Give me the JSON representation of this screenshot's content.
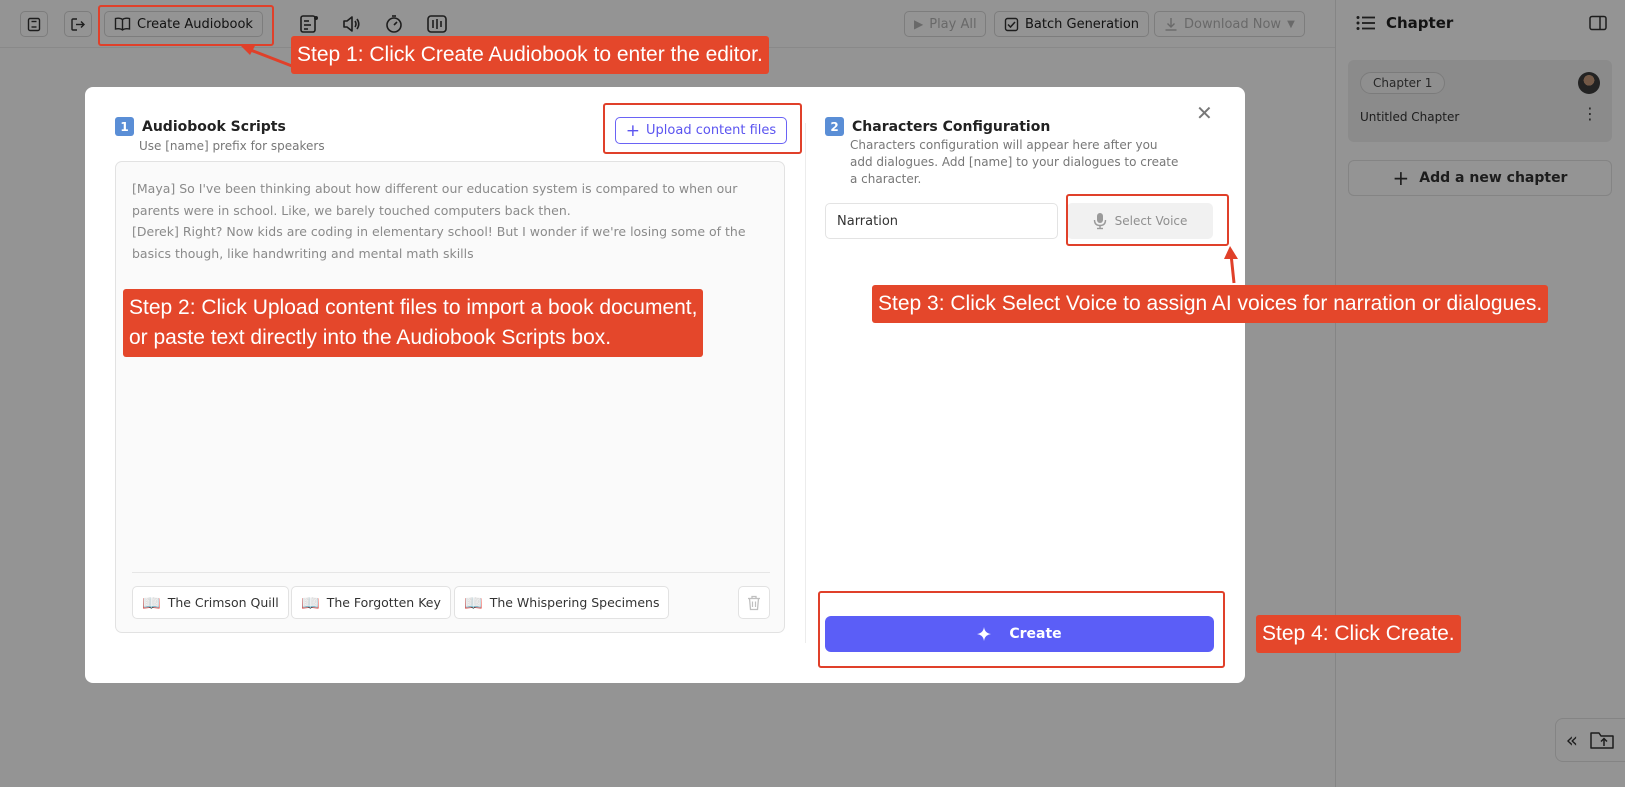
{
  "toolbar": {
    "create_audiobook_label": "Create Audiobook",
    "play_all_label": "Play All",
    "batch_generation_label": "Batch Generation",
    "download_now_label": "Download Now"
  },
  "right_panel": {
    "title": "Chapter",
    "chapter_pill": "Chapter 1",
    "chapter_name": "Untitled Chapter",
    "add_chapter_label": "Add a new chapter"
  },
  "modal": {
    "scripts": {
      "badge": "1",
      "title": "Audiobook Scripts",
      "subtitle": "Use [name] prefix for speakers",
      "upload_label": "Upload content files",
      "script_lines": [
        "[Maya] So I've been thinking about how different our education system is compared to when our parents were in school. Like, we barely touched computers back then.",
        "[Derek] Right? Now kids are coding in elementary school! But I wonder if we're losing some of the basics though, like handwriting and mental math skills"
      ],
      "samples": [
        "The Crimson Quill",
        "The Forgotten Key",
        "The Whispering Specimens"
      ]
    },
    "characters": {
      "badge": "2",
      "title": "Characters Configuration",
      "subtitle": "Characters configuration will appear here after you add dialogues. Add [name] to your dialogues to create a character.",
      "narration_value": "Narration",
      "select_voice_label": "Select Voice"
    },
    "create_label": "Create"
  },
  "callouts": {
    "step1": "Step 1: Click Create Audiobook to enter the editor.",
    "step2_line1": "Step 2: Click Upload content files to import a book document,",
    "step2_line2": "or paste text directly into the Audiobook Scripts box.",
    "step3": "Step 3: Click Select Voice to assign AI voices for narration or dialogues.",
    "step4": "Step 4: Click Create."
  },
  "colors": {
    "accent": "#5b5ef7",
    "callout": "#e4472b",
    "highlight": "#e0402a"
  }
}
